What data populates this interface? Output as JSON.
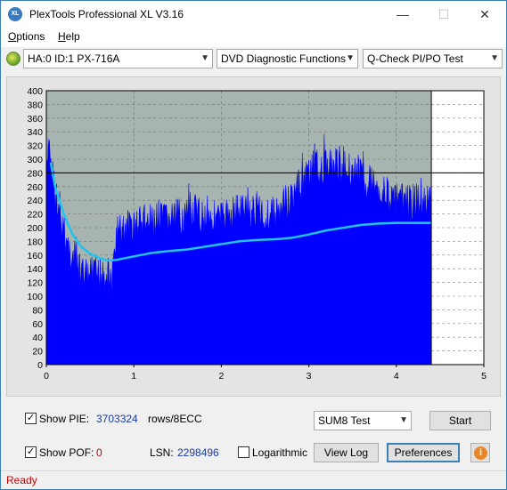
{
  "window": {
    "title": "PlexTools Professional XL V3.16",
    "icon_text": "XL",
    "minimize": "—",
    "maximize": "☐",
    "close": "✕"
  },
  "menu": {
    "items": [
      {
        "label": "Options",
        "accel": "O"
      },
      {
        "label": "Help",
        "accel": "H"
      }
    ]
  },
  "toolbar": {
    "drive": "HA:0 ID:1  PX-716A",
    "function": "DVD Diagnostic Functions",
    "test": "Q-Check PI/PO Test"
  },
  "chart_data": {
    "type": "area",
    "x_ticks": [
      "0",
      "1",
      "2",
      "3",
      "4",
      "5"
    ],
    "y_ticks": [
      "0",
      "20",
      "40",
      "60",
      "80",
      "100",
      "120",
      "140",
      "160",
      "180",
      "200",
      "220",
      "240",
      "260",
      "280",
      "300",
      "320",
      "340",
      "360",
      "380",
      "400"
    ],
    "xlim": [
      0,
      5
    ],
    "ylim": [
      0,
      400
    ],
    "end_marker_x": 4.4,
    "threshold_y": 280,
    "colors": {
      "area": "#0000ff",
      "trend": "#1fc4ef",
      "plot_bg": "#ffffff",
      "grid": "#555555",
      "unused_bg": "#a8b4b0"
    },
    "pie_envelope": [
      [
        0.0,
        290
      ],
      [
        0.03,
        350
      ],
      [
        0.08,
        300
      ],
      [
        0.12,
        250
      ],
      [
        0.2,
        220
      ],
      [
        0.3,
        180
      ],
      [
        0.4,
        160
      ],
      [
        0.5,
        155
      ],
      [
        0.6,
        160
      ],
      [
        0.7,
        160
      ],
      [
        0.75,
        145
      ],
      [
        0.8,
        220
      ],
      [
        0.9,
        225
      ],
      [
        1.0,
        230
      ],
      [
        1.2,
        235
      ],
      [
        1.4,
        240
      ],
      [
        1.6,
        245
      ],
      [
        1.8,
        245
      ],
      [
        2.0,
        240
      ],
      [
        2.2,
        255
      ],
      [
        2.5,
        245
      ],
      [
        2.7,
        250
      ],
      [
        2.8,
        270
      ],
      [
        3.0,
        310
      ],
      [
        3.2,
        320
      ],
      [
        3.4,
        320
      ],
      [
        3.6,
        305
      ],
      [
        3.8,
        285
      ],
      [
        4.0,
        265
      ],
      [
        4.2,
        265
      ],
      [
        4.4,
        260
      ]
    ],
    "trend": [
      [
        0.05,
        295
      ],
      [
        0.1,
        260
      ],
      [
        0.2,
        220
      ],
      [
        0.3,
        190
      ],
      [
        0.4,
        172
      ],
      [
        0.5,
        162
      ],
      [
        0.6,
        156
      ],
      [
        0.7,
        152
      ],
      [
        0.8,
        153
      ],
      [
        1.0,
        158
      ],
      [
        1.2,
        163
      ],
      [
        1.4,
        166
      ],
      [
        1.6,
        168
      ],
      [
        1.8,
        172
      ],
      [
        2.0,
        176
      ],
      [
        2.2,
        180
      ],
      [
        2.4,
        182
      ],
      [
        2.6,
        183
      ],
      [
        2.8,
        185
      ],
      [
        3.0,
        190
      ],
      [
        3.2,
        196
      ],
      [
        3.4,
        200
      ],
      [
        3.6,
        204
      ],
      [
        3.8,
        206
      ],
      [
        4.0,
        207
      ],
      [
        4.2,
        207
      ],
      [
        4.4,
        207
      ]
    ]
  },
  "controls": {
    "show_pie_label": "Show PIE:",
    "show_pie_checked": "✓",
    "pie_value": "3703324",
    "pie_unit": "rows/8ECC",
    "show_pof_label": "Show POF:",
    "show_pof_checked": "✓",
    "pof_value": "0",
    "lsn_label": "LSN:",
    "lsn_value": "2298496",
    "logarithmic_label": "Logarithmic",
    "sum_select": "SUM8 Test",
    "start_button": "Start",
    "view_log_button": "View Log",
    "preferences_button": "Preferences",
    "info_button": "i"
  },
  "status": {
    "text": "Ready"
  }
}
